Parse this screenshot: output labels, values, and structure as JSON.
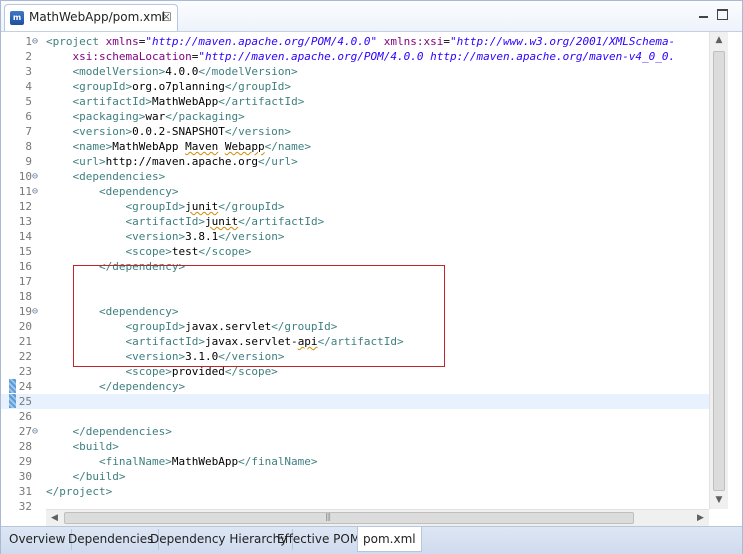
{
  "tab": {
    "title": "MathWebApp/pom.xml",
    "close": "☒"
  },
  "bottom_tabs": [
    {
      "label": "Overview"
    },
    {
      "label": "Dependencies"
    },
    {
      "label": "Dependency Hierarchy"
    },
    {
      "label": "Effective POM"
    },
    {
      "label": "pom.xml",
      "active": true
    }
  ],
  "editor": {
    "current_line": 25,
    "highlight_lines": [
      19,
      24
    ],
    "lines": [
      {
        "n": "1",
        "fold": true,
        "tokens": [
          [
            "t",
            "<project "
          ],
          [
            "a",
            "xmlns"
          ],
          [
            "x",
            "="
          ],
          [
            "v",
            "\"http://maven.apache.org/POM/4.0.0\""
          ],
          [
            "x",
            " "
          ],
          [
            "a",
            "xmlns:xsi"
          ],
          [
            "x",
            "="
          ],
          [
            "v",
            "\"http://www.w3.org/2001/XMLSchema-"
          ]
        ]
      },
      {
        "n": "2",
        "tokens": [
          [
            "x",
            "    "
          ],
          [
            "a",
            "xsi:schemaLocation"
          ],
          [
            "x",
            "="
          ],
          [
            "v",
            "\"http://maven.apache.org/POM/4.0.0 http://maven.apache.org/maven-v4_0_0."
          ]
        ]
      },
      {
        "n": "3",
        "tokens": [
          [
            "x",
            "    "
          ],
          [
            "t",
            "<modelVersion>"
          ],
          [
            "x",
            "4.0.0"
          ],
          [
            "t",
            "</modelVersion>"
          ]
        ]
      },
      {
        "n": "4",
        "tokens": [
          [
            "x",
            "    "
          ],
          [
            "t",
            "<groupId>"
          ],
          [
            "x",
            "org.o7planning"
          ],
          [
            "t",
            "</groupId>"
          ]
        ]
      },
      {
        "n": "5",
        "tokens": [
          [
            "x",
            "    "
          ],
          [
            "t",
            "<artifactId>"
          ],
          [
            "x",
            "MathWebApp"
          ],
          [
            "t",
            "</artifactId>"
          ]
        ]
      },
      {
        "n": "6",
        "tokens": [
          [
            "x",
            "    "
          ],
          [
            "t",
            "<packaging>"
          ],
          [
            "x",
            "war"
          ],
          [
            "t",
            "</packaging>"
          ]
        ]
      },
      {
        "n": "7",
        "tokens": [
          [
            "x",
            "    "
          ],
          [
            "t",
            "<version>"
          ],
          [
            "x",
            "0.0.2-SNAPSHOT"
          ],
          [
            "t",
            "</version>"
          ]
        ]
      },
      {
        "n": "8",
        "tokens": [
          [
            "x",
            "    "
          ],
          [
            "t",
            "<name>"
          ],
          [
            "x",
            "MathWebApp "
          ],
          [
            "s",
            "Maven"
          ],
          [
            "x",
            " "
          ],
          [
            "s",
            "Webapp"
          ],
          [
            "t",
            "</name>"
          ]
        ]
      },
      {
        "n": "9",
        "tokens": [
          [
            "x",
            "    "
          ],
          [
            "t",
            "<url>"
          ],
          [
            "x",
            "http://maven.apache.org"
          ],
          [
            "t",
            "</url>"
          ]
        ]
      },
      {
        "n": "10",
        "fold": true,
        "tokens": [
          [
            "x",
            "    "
          ],
          [
            "t",
            "<dependencies>"
          ]
        ]
      },
      {
        "n": "11",
        "fold": true,
        "tokens": [
          [
            "x",
            "        "
          ],
          [
            "t",
            "<dependency>"
          ]
        ]
      },
      {
        "n": "12",
        "tokens": [
          [
            "x",
            "            "
          ],
          [
            "t",
            "<groupId>"
          ],
          [
            "s",
            "junit"
          ],
          [
            "t",
            "</groupId>"
          ]
        ]
      },
      {
        "n": "13",
        "tokens": [
          [
            "x",
            "            "
          ],
          [
            "t",
            "<artifactId>"
          ],
          [
            "s",
            "junit"
          ],
          [
            "t",
            "</artifactId>"
          ]
        ]
      },
      {
        "n": "14",
        "tokens": [
          [
            "x",
            "            "
          ],
          [
            "t",
            "<version>"
          ],
          [
            "x",
            "3.8.1"
          ],
          [
            "t",
            "</version>"
          ]
        ]
      },
      {
        "n": "15",
        "tokens": [
          [
            "x",
            "            "
          ],
          [
            "t",
            "<scope>"
          ],
          [
            "x",
            "test"
          ],
          [
            "t",
            "</scope>"
          ]
        ]
      },
      {
        "n": "16",
        "tokens": [
          [
            "x",
            "        "
          ],
          [
            "t",
            "</dependency>"
          ]
        ]
      },
      {
        "n": "17",
        "tokens": []
      },
      {
        "n": "18",
        "tokens": []
      },
      {
        "n": "19",
        "fold": true,
        "tokens": [
          [
            "x",
            "        "
          ],
          [
            "t",
            "<dependency>"
          ]
        ]
      },
      {
        "n": "20",
        "tokens": [
          [
            "x",
            "            "
          ],
          [
            "t",
            "<groupId>"
          ],
          [
            "x",
            "javax.servlet"
          ],
          [
            "t",
            "</groupId>"
          ]
        ]
      },
      {
        "n": "21",
        "tokens": [
          [
            "x",
            "            "
          ],
          [
            "t",
            "<artifactId>"
          ],
          [
            "x",
            "javax.servlet-"
          ],
          [
            "s",
            "api"
          ],
          [
            "t",
            "</artifactId>"
          ]
        ]
      },
      {
        "n": "22",
        "tokens": [
          [
            "x",
            "            "
          ],
          [
            "t",
            "<version>"
          ],
          [
            "x",
            "3.1.0"
          ],
          [
            "t",
            "</version>"
          ]
        ]
      },
      {
        "n": "23",
        "tokens": [
          [
            "x",
            "            "
          ],
          [
            "t",
            "<scope>"
          ],
          [
            "x",
            "provided"
          ],
          [
            "t",
            "</scope>"
          ]
        ]
      },
      {
        "n": "24",
        "tokens": [
          [
            "x",
            "        "
          ],
          [
            "t",
            "</dependency>"
          ]
        ]
      },
      {
        "n": "25",
        "tokens": []
      },
      {
        "n": "26",
        "tokens": []
      },
      {
        "n": "27",
        "fold": true,
        "tokens": [
          [
            "x",
            "    "
          ],
          [
            "t",
            "</dependencies>"
          ]
        ]
      },
      {
        "n": "28",
        "tokens": [
          [
            "x",
            "    "
          ],
          [
            "t",
            "<build>"
          ]
        ]
      },
      {
        "n": "29",
        "tokens": [
          [
            "x",
            "        "
          ],
          [
            "t",
            "<finalName>"
          ],
          [
            "x",
            "MathWebApp"
          ],
          [
            "t",
            "</finalName>"
          ]
        ]
      },
      {
        "n": "30",
        "tokens": [
          [
            "x",
            "    "
          ],
          [
            "t",
            "</build>"
          ]
        ]
      },
      {
        "n": "31",
        "tokens": [
          [
            "t",
            "</project>"
          ]
        ]
      },
      {
        "n": "32",
        "tokens": []
      }
    ]
  },
  "scrollbar": {
    "up": "▲",
    "down": "▼",
    "left": "◀",
    "right": "▶",
    "grip": "|||"
  },
  "colors": {
    "tag": "#3f7f7f",
    "attr_name": "#7f007f",
    "attr_value": "#2a00ff",
    "selection_box": "#c0252a",
    "current_line": "#e8f2fe"
  }
}
